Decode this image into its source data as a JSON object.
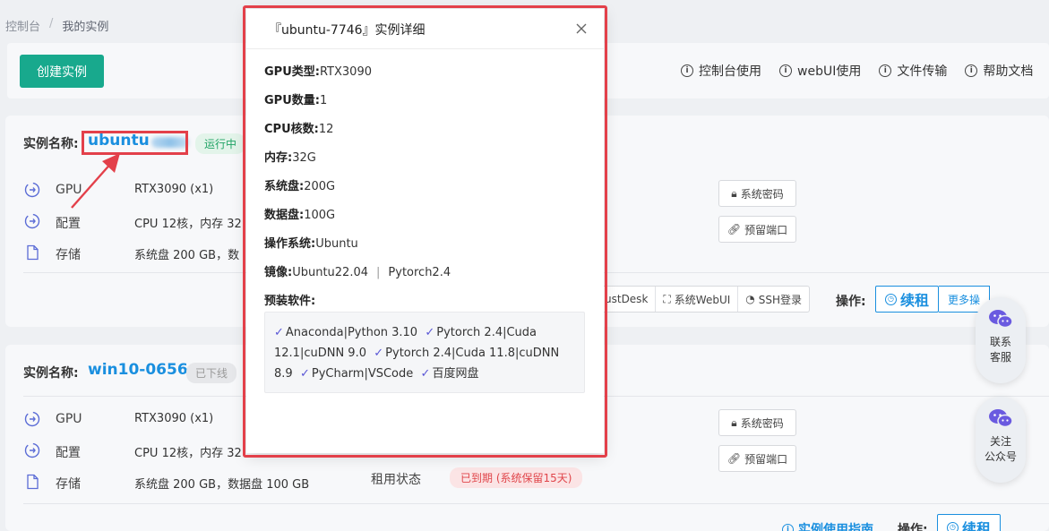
{
  "breadcrumb": {
    "root": "控制台",
    "current": "我的实例"
  },
  "toolbar": {
    "create_label": "创建实例",
    "help_links": [
      "控制台使用",
      "webUI使用",
      "文件传输",
      "帮助文档"
    ]
  },
  "instances": [
    {
      "label": "实例名称:",
      "name": "ubuntu",
      "status": "运行中",
      "specs": [
        {
          "label": "GPU",
          "value": "RTX3090 (x1)"
        },
        {
          "label": "配置",
          "value": "CPU 12核，内存 32"
        },
        {
          "label": "存储",
          "value": "系统盘 200 GB，数"
        }
      ],
      "buttons": {
        "password": "系统密码",
        "port": "预留端口"
      },
      "ops": [
        "ustDesk",
        "系统WebUI",
        "SSH登录"
      ],
      "ops_label": "操作:",
      "renew": "续租",
      "more": "更多操"
    },
    {
      "label": "实例名称:",
      "name": "win10-0656",
      "status": "已下线",
      "specs": [
        {
          "label": "GPU",
          "value": "RTX3090 (x1)"
        },
        {
          "label": "配置",
          "value": "CPU 12核，内存 32"
        },
        {
          "label": "存储",
          "value": "系统盘 200 GB，数据盘 100 GB"
        }
      ],
      "rental_label": "租用状态",
      "rental_status": "已到期 (系统保留15天)",
      "buttons": {
        "password": "系统密码",
        "port": "预留端口"
      },
      "guide": "实例使用指南",
      "ops_label": "操作:",
      "renew": "续租"
    }
  ],
  "floating": {
    "service": [
      "联系",
      "客服"
    ],
    "follow": [
      "关注",
      "公众号"
    ]
  },
  "modal": {
    "title": "『ubuntu-7746』实例详细",
    "rows": [
      {
        "label": "GPU类型:",
        "value": "RTX3090"
      },
      {
        "label": "GPU数量:",
        "value": "1"
      },
      {
        "label": "CPU核数:",
        "value": "12"
      },
      {
        "label": "内存:",
        "value": "32G"
      },
      {
        "label": "系统盘:",
        "value": "200G"
      },
      {
        "label": "数据盘:",
        "value": "100G"
      },
      {
        "label": "操作系统:",
        "value": "Ubuntu"
      }
    ],
    "image_label": "镜像:",
    "image_os": "Ubuntu22.04",
    "image_fw": "Pytorch2.4",
    "software_label": "预装软件:",
    "software": [
      "Anaconda|Python 3.10",
      "Pytorch 2.4|Cuda 12.1|cuDNN 9.0",
      "Pytorch 2.4|Cuda 11.8|cuDNN 8.9",
      "PyCharm|VSCode",
      "百度网盘"
    ]
  },
  "colors": {
    "accent": "#18a98d",
    "link": "#1a8fdf",
    "highlight": "#e3404a",
    "check": "#5a57d6"
  }
}
